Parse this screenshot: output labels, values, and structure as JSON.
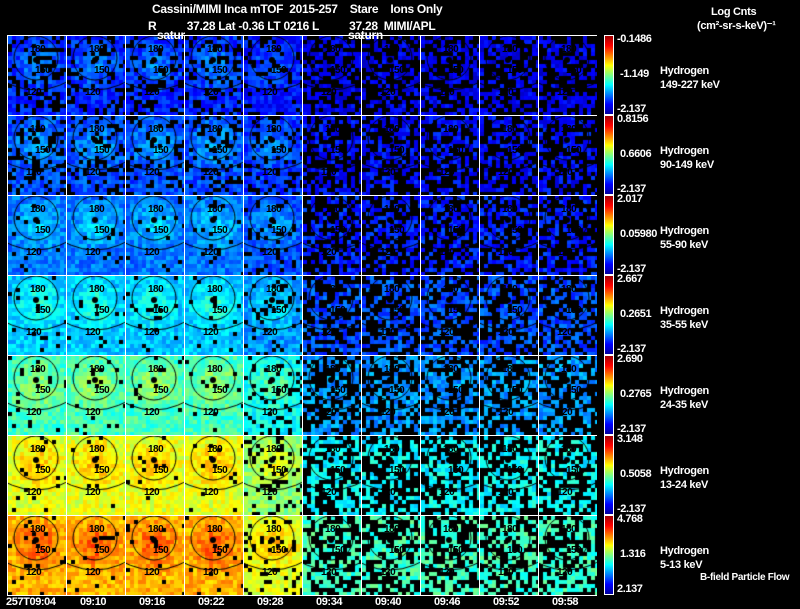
{
  "header": {
    "title": "Cassini/MIMI Inca mTOF  2015-257    Stare    Ions Only",
    "subtitle": "R          37.28 Lat -0.36 LT 0216 L          37.28  MIMI/APL",
    "saturn_label_1": "satur",
    "saturn_label_2": "saturn"
  },
  "legend": {
    "units_line1": "Log Cnts",
    "units_line2": "(cm²-sr-s-keV)⁻¹",
    "footer": "B-field Particle Flow"
  },
  "colormap": [
    "#0000a0",
    "#0000ff",
    "#0080ff",
    "#00ffff",
    "#80ff80",
    "#ffff00",
    "#ff8000",
    "#ff0000",
    "#a00000"
  ],
  "contour_labels": [
    "180",
    "150",
    "120"
  ],
  "chart_data": {
    "type": "heatmap",
    "title": "Cassini/MIMI Inca mTOF  2015-257    Stare    Ions Only",
    "time_ticks": [
      "257T09:04",
      "09:10",
      "09:16",
      "09:22",
      "09:28",
      "09:34",
      "09:40",
      "09:46",
      "09:52",
      "09:58"
    ],
    "rows": [
      {
        "species": "Hydrogen",
        "energy": "149-227 keV",
        "max": "-0.1486",
        "mid": "-1.149",
        "min": "-2.137"
      },
      {
        "species": "Hydrogen",
        "energy": "90-149 keV",
        "max": "0.8156",
        "mid": "0.6606",
        "min": "-2.137"
      },
      {
        "species": "Hydrogen",
        "energy": "55-90 keV",
        "max": "2.017",
        "mid": "0.05980",
        "min": "-2.137"
      },
      {
        "species": "Hydrogen",
        "energy": "35-55 keV",
        "max": "2.667",
        "mid": "0.2651",
        "min": "-2.137"
      },
      {
        "species": "Hydrogen",
        "energy": "24-35 keV",
        "max": "2.690",
        "mid": "0.2765",
        "min": "-2.137"
      },
      {
        "species": "Hydrogen",
        "energy": "13-24 keV",
        "max": "3.148",
        "mid": "0.5058",
        "min": "-2.137"
      },
      {
        "species": "Hydrogen",
        "energy": "5-13 keV",
        "max": "4.768",
        "mid": "1.316",
        "min": "2.137"
      }
    ]
  }
}
